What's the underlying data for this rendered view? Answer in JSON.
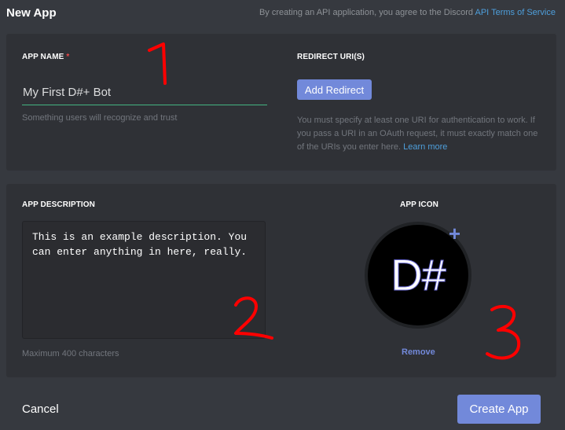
{
  "header": {
    "title": "New App",
    "terms_prefix": "By creating an API application, you agree to the Discord ",
    "terms_link": "API Terms of Service"
  },
  "app_name": {
    "label": "APP NAME",
    "required_mark": "*",
    "value": "My First D#+ Bot",
    "hint": "Something users will recognize and trust"
  },
  "redirect": {
    "label": "REDIRECT URI(S)",
    "button": "Add Redirect",
    "info": "You must specify at least one URI for authentication to work. If you pass a URI in an OAuth request, it must exactly match one of the URIs you enter here. ",
    "learn_more": "Learn more"
  },
  "description": {
    "label": "APP DESCRIPTION",
    "value": "This is an example description. You can enter anything in here, really.",
    "hint": "Maximum 400 characters"
  },
  "icon": {
    "label": "APP ICON",
    "text": "D#",
    "plus": "+",
    "remove": "Remove"
  },
  "footer": {
    "cancel": "Cancel",
    "create": "Create App"
  },
  "annotations": [
    "1",
    "2",
    "3"
  ],
  "colors": {
    "background": "#36393f",
    "panel": "#2f3136",
    "accent": "#7289da",
    "link": "#4e9fdc",
    "input_underline": "#43b581",
    "annotation": "#ff0000"
  }
}
